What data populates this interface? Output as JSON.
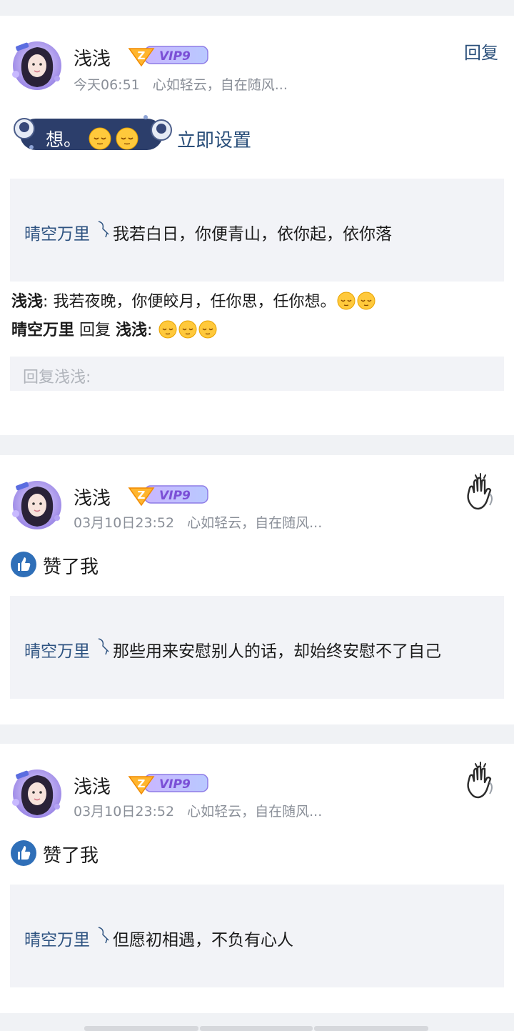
{
  "posts": [
    {
      "author": "浅浅",
      "vip_label": "VIP9",
      "time": "今天06:51",
      "signature": "心如轻云，自在随风...",
      "reply_action": "回复",
      "bubble_text": "想。",
      "setup_link": "立即设置",
      "quote_author": "晴空万里",
      "quote_text": "我若白日，你便青山，依你起，依你落",
      "comments": [
        {
          "author": "浅浅",
          "sep": ":",
          "text": "我若夜晚，你便皎月，任你思，任你想。"
        },
        {
          "author": "晴空万里",
          "reply_word": "回复",
          "target": "浅浅",
          "sep": ":"
        }
      ],
      "reply_placeholder": "回复浅浅:"
    },
    {
      "author": "浅浅",
      "vip_label": "VIP9",
      "time": "03月10日23:52",
      "signature": "心如轻云，自在随风...",
      "liked_text": "赞了我",
      "quote_author": "晴空万里",
      "quote_text": "那些用来安慰别人的话，却始终安慰不了自己"
    },
    {
      "author": "浅浅",
      "vip_label": "VIP9",
      "time": "03月10日23:52",
      "signature": "心如轻云，自在随风...",
      "liked_text": "赞了我",
      "quote_author": "晴空万里",
      "quote_text": "但愿初相遇，不负有心人"
    }
  ],
  "colors": {
    "link": "#2a4f7a",
    "meta": "#8a8f98",
    "quote_bg": "#f2f3f7",
    "page_bg": "#f0f2f5",
    "like_blue": "#2f6fb8",
    "vip_purple": "#7b4fd6"
  },
  "icons": [
    "avatar-girl",
    "vip-badge",
    "wave-hand-icon",
    "like-thumb-icon",
    "sleepy-emoji"
  ]
}
